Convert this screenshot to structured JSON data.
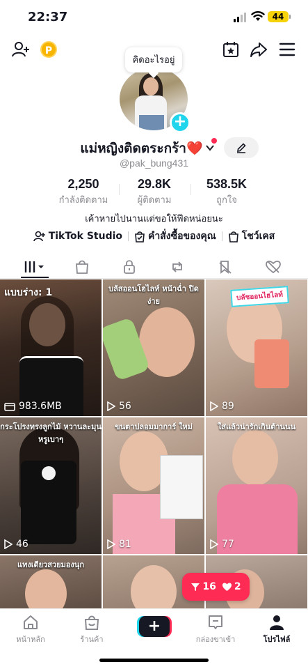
{
  "status_bar": {
    "time": "22:37",
    "battery": "44"
  },
  "profile": {
    "bubble_text": "คิดอะไรอยู่",
    "name": "แม่หญิงติดตระกร้า❤️",
    "handle": "@pak_bung431",
    "stats": [
      {
        "value": "2,250",
        "label": "กำลังติดตาม"
      },
      {
        "value": "29.8K",
        "label": "ผู้ติดตาม"
      },
      {
        "value": "538.5K",
        "label": "ถูกใจ"
      }
    ],
    "bio": "เค้าหายไปนานแต่ขอให้ฟีดหน่อยนะ",
    "links": [
      {
        "label": "TikTok Studio",
        "icon": "person-plus-icon"
      },
      {
        "label": "คำสั่งซื้อของคุณ",
        "icon": "order-bag-icon"
      },
      {
        "label": "โชว์เคส",
        "icon": "showcase-bag-icon"
      }
    ]
  },
  "grid": {
    "videos": [
      {
        "badge": "แบบร่าง: 1",
        "views": "983.6MB",
        "caption": "",
        "kind": "draft"
      },
      {
        "badge": "",
        "views": "56",
        "caption": "บลัสออนโฮไลท์ หน้าฉ่ำ ปิดง่าย",
        "kind": "play"
      },
      {
        "badge": "บลัชออนไฮไลท์",
        "views": "89",
        "caption": "",
        "kind": "play"
      },
      {
        "badge": "",
        "views": "46",
        "caption": "กระโปรงทรงลูกไม้ หวานละมุน หรูเบาๆ",
        "kind": "play"
      },
      {
        "badge": "",
        "views": "81",
        "caption": "ขนตาปลอมมาการ์ ใหม่",
        "kind": "play"
      },
      {
        "badge": "",
        "views": "77",
        "caption": "ใส่แล้วน่ารักเกินต้านนน",
        "kind": "play"
      },
      {
        "badge": "",
        "views": "",
        "caption": "แทงเดียวสวยมองนุก",
        "kind": "play"
      },
      {
        "badge": "",
        "views": "",
        "caption": "",
        "kind": "play"
      },
      {
        "badge": "",
        "views": "",
        "caption": "",
        "kind": "play"
      }
    ]
  },
  "notification": {
    "views": "16",
    "likes": "2"
  },
  "nav": {
    "items": [
      {
        "label": "หน้าหลัก",
        "icon": "home-icon"
      },
      {
        "label": "ร้านค้า",
        "icon": "shop-icon"
      },
      {
        "label": "",
        "icon": "create-icon"
      },
      {
        "label": "กล่องขาเข้า",
        "icon": "inbox-icon"
      },
      {
        "label": "โปรไฟล์",
        "icon": "profile-icon"
      }
    ]
  },
  "colors": {
    "accent": "#fe2c55",
    "cyan": "#20d5ec",
    "battery": "#f5d20a"
  }
}
